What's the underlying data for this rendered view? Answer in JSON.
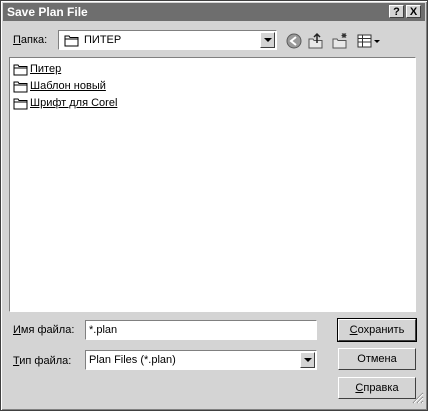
{
  "title": "Save Plan File",
  "titlebar": {
    "help_label": "?",
    "close_label": "X"
  },
  "lookin": {
    "label_accel": "П",
    "label_rest": "апка:",
    "value": "ПИТЕР",
    "icon": "folder-icon"
  },
  "toolbar": [
    "back-icon",
    "up-folder-icon",
    "new-folder-icon",
    "view-menu-icon"
  ],
  "files": [
    {
      "label": "Питер",
      "icon": "folder-icon"
    },
    {
      "label": "Шаблон новый",
      "icon": "folder-icon"
    },
    {
      "label": "Шрифт для Corel",
      "icon": "folder-icon"
    }
  ],
  "filename": {
    "label_accel": "И",
    "label_rest": "мя файла:",
    "value": "*.plan"
  },
  "filetype": {
    "label_accel": "Т",
    "label_rest": "ип файла:",
    "value": "Plan Files (*.plan)"
  },
  "buttons": {
    "save_accel": "С",
    "save_rest": "охранить",
    "cancel": "Отмена",
    "help_accel": "С",
    "help_rest": "правка"
  },
  "colors": {
    "titlebar": "#6e6e6e",
    "face": "#d4d4d4",
    "window": "#ffffff"
  }
}
